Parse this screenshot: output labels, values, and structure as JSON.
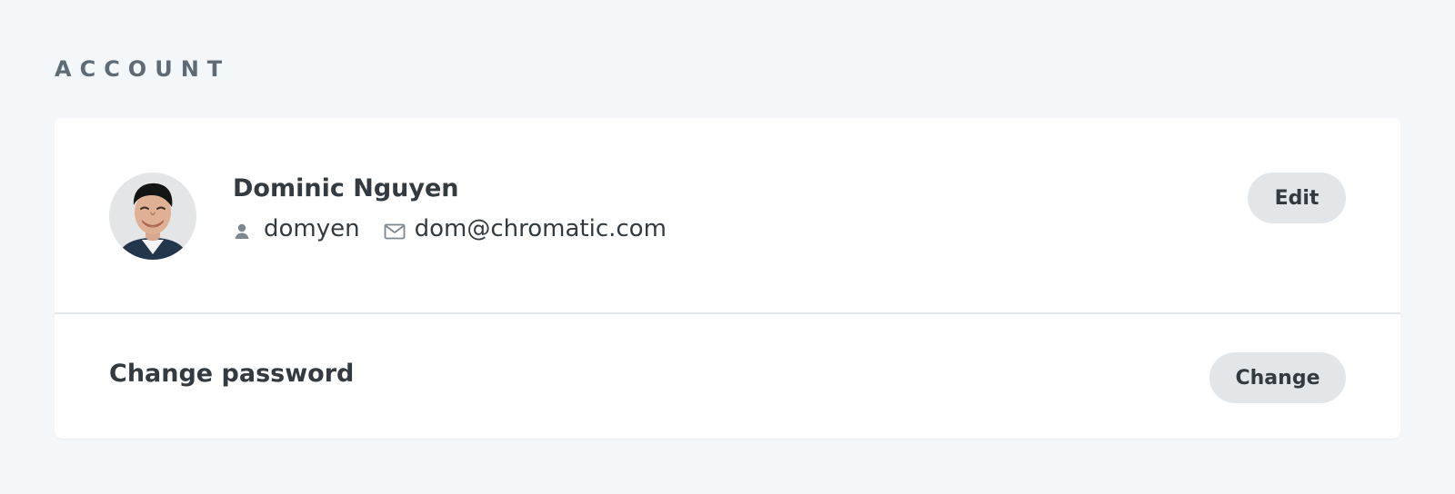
{
  "section": {
    "title": "Account"
  },
  "profile": {
    "name": "Dominic Nguyen",
    "username": "domyen",
    "email": "dom@chromatic.com",
    "avatar_icon": "avatar-photo",
    "username_icon": "user-icon",
    "email_icon": "mail-icon",
    "edit_label": "Edit"
  },
  "password": {
    "label": "Change password",
    "button_label": "Change"
  },
  "colors": {
    "page_background": "#f4f7fa",
    "card_background": "#ffffff",
    "button_background": "#e3e6e9",
    "text_primary": "#333a40",
    "text_muted": "#5f6b74",
    "icon_gray": "#7d8790",
    "divider": "#e3e6e9"
  }
}
